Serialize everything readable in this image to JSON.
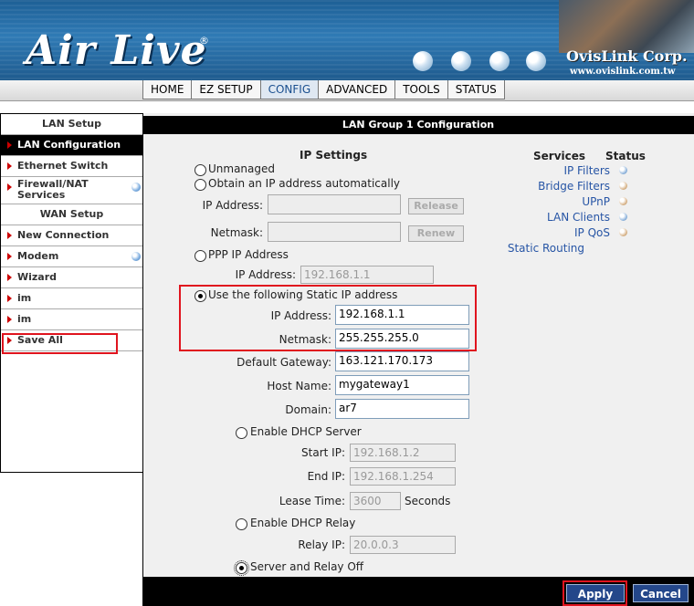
{
  "header": {
    "logo": "Air Live",
    "logo_mark": "®",
    "company": "OvisLink Corp.",
    "company_url": "www.ovislink.com.tw"
  },
  "nav": {
    "tabs": [
      {
        "label": "HOME"
      },
      {
        "label": "EZ SETUP"
      },
      {
        "label": "CONFIG",
        "active": true
      },
      {
        "label": "ADVANCED"
      },
      {
        "label": "TOOLS"
      },
      {
        "label": "STATUS"
      }
    ]
  },
  "sidebar": {
    "lan_header": "LAN Setup",
    "wan_header": "WAN Setup",
    "items": {
      "lan_configuration": "LAN Configuration",
      "ethernet_switch": "Ethernet Switch",
      "firewall_line1": "Firewall/NAT",
      "firewall_line2": "Services",
      "new_connection": "New Connection",
      "modem": "Modem",
      "wizard": "Wizard",
      "im1": "im",
      "im2": "im",
      "save_all": "Save All"
    }
  },
  "content": {
    "title": "LAN Group 1 Configuration",
    "ip_settings": "IP Settings",
    "unmanaged": "Unmanaged",
    "obtain_auto": "Obtain an IP address automatically",
    "ip_address_label": "IP Address:",
    "netmask_label": "Netmask:",
    "release": "Release",
    "renew": "Renew",
    "ppp_ip": "PPP IP Address",
    "ppp_ip_value": "192.168.1.1",
    "use_static": "Use the following Static IP address",
    "static_ip": "192.168.1.1",
    "static_netmask": "255.255.255.0",
    "default_gateway_label": "Default Gateway:",
    "default_gateway": "163.121.170.173",
    "host_name_label": "Host Name:",
    "host_name": "mygateway1",
    "domain_label": "Domain:",
    "domain": "ar7",
    "enable_dhcp_server": "Enable DHCP Server",
    "start_ip_label": "Start IP:",
    "start_ip": "192.168.1.2",
    "end_ip_label": "End IP:",
    "end_ip": "192.168.1.254",
    "lease_time_label": "Lease Time:",
    "lease_time": "3600",
    "seconds": "Seconds",
    "enable_dhcp_relay": "Enable DHCP Relay",
    "relay_ip_label": "Relay IP:",
    "relay_ip": "20.0.0.3",
    "server_relay_off": "Server and Relay Off"
  },
  "services": {
    "header": "Services",
    "status_header": "Status",
    "items": [
      {
        "label": "IP Filters",
        "status": "blue"
      },
      {
        "label": "Bridge Filters",
        "status": "tan"
      },
      {
        "label": "UPnP",
        "status": "tan"
      },
      {
        "label": "LAN Clients",
        "status": "blue"
      },
      {
        "label": "IP QoS",
        "status": "tan"
      },
      {
        "label": "Static Routing"
      }
    ]
  },
  "footer": {
    "apply": "Apply",
    "cancel": "Cancel"
  },
  "colors": {
    "highlight": "#e0141e",
    "button": "#24478a",
    "link": "#2755a5"
  }
}
